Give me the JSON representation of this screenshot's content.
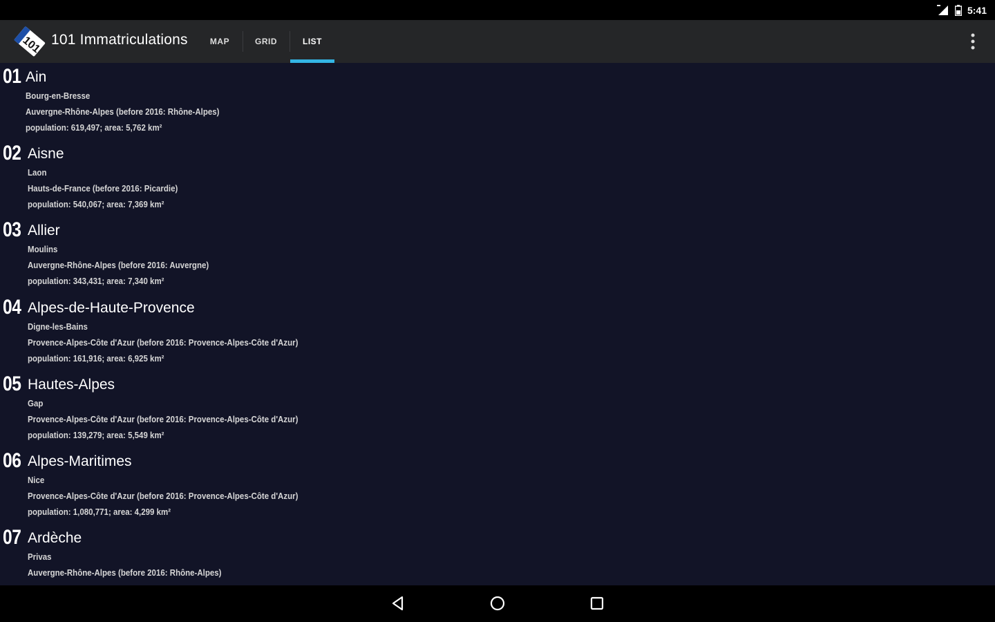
{
  "status_bar": {
    "time": "5:41",
    "icons": [
      "signal-icon",
      "battery-icon"
    ]
  },
  "app": {
    "title": "101 Immatriculations",
    "logo_text": "101"
  },
  "tabs": [
    {
      "label": "MAP",
      "selected": false
    },
    {
      "label": "GRID",
      "selected": false
    },
    {
      "label": "LIST",
      "selected": true
    }
  ],
  "accent_color": "#33b5e5",
  "departments": [
    {
      "code": "01",
      "name": "Ain",
      "prefecture": "Bourg-en-Bresse",
      "region": "Auvergne-Rhône-Alpes (before 2016: Rhône-Alpes)",
      "stats": "population: 619,497; area: 5,762 km²"
    },
    {
      "code": "02",
      "name": "Aisne",
      "prefecture": "Laon",
      "region": "Hauts-de-France (before 2016: Picardie)",
      "stats": "population: 540,067; area: 7,369 km²"
    },
    {
      "code": "03",
      "name": "Allier",
      "prefecture": "Moulins",
      "region": "Auvergne-Rhône-Alpes (before 2016: Auvergne)",
      "stats": "population: 343,431; area: 7,340 km²"
    },
    {
      "code": "04",
      "name": "Alpes-de-Haute-Provence",
      "prefecture": "Digne-les-Bains",
      "region": "Provence-Alpes-Côte d'Azur (before 2016: Provence-Alpes-Côte d'Azur)",
      "stats": "population: 161,916; area: 6,925 km²"
    },
    {
      "code": "05",
      "name": "Hautes-Alpes",
      "prefecture": "Gap",
      "region": "Provence-Alpes-Côte d'Azur (before 2016: Provence-Alpes-Côte d'Azur)",
      "stats": "population: 139,279; area: 5,549 km²"
    },
    {
      "code": "06",
      "name": "Alpes-Maritimes",
      "prefecture": "Nice",
      "region": "Provence-Alpes-Côte d'Azur (before 2016: Provence-Alpes-Côte d'Azur)",
      "stats": "population: 1,080,771; area: 4,299 km²"
    },
    {
      "code": "07",
      "name": "Ardèche",
      "prefecture": "Privas",
      "region": "Auvergne-Rhône-Alpes (before 2016: Rhône-Alpes)",
      "stats": ""
    }
  ],
  "nav": [
    "back-icon",
    "home-icon",
    "recents-icon"
  ]
}
